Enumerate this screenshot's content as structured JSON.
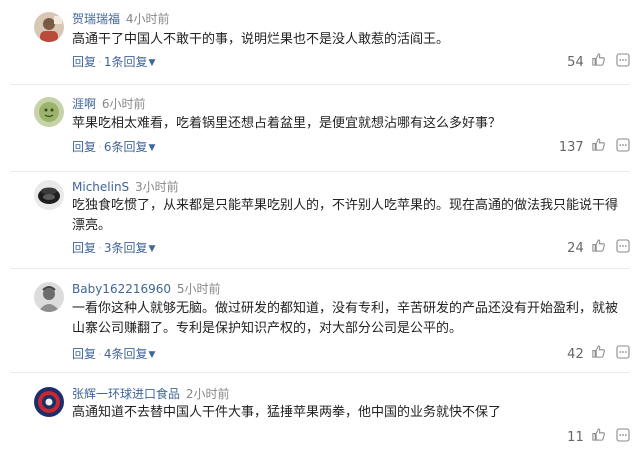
{
  "comments": [
    {
      "username": "贺瑞瑞福",
      "time": "4小时前",
      "text": "高通干了中国人不敢干的事，说明烂果也不是没人敢惹的活阎王。",
      "reply_label": "回复",
      "replies_label": "1条回复",
      "likes": "54"
    },
    {
      "username": "涯啊",
      "time": "6小时前",
      "text": "苹果吃相太难看，吃着锅里还想占着盆里，是便宜就想沾哪有这么多好事？",
      "reply_label": "回复",
      "replies_label": "6条回复",
      "likes": "137"
    },
    {
      "username": "MichelinS",
      "time": "3小时前",
      "text": "吃独食吃惯了，从来都是只能苹果吃别人的，不许别人吃苹果的。现在高通的做法我只能说干得漂亮。",
      "reply_label": "回复",
      "replies_label": "3条回复",
      "likes": "24"
    },
    {
      "username": "Baby162216960",
      "time": "5小时前",
      "text": "一看你这种人就够无脑。做过研发的都知道，没有专利，辛苦研发的产品还没有开始盈利，就被山寨公司赚翻了。专利是保护知识产权的，对大部分公司是公平的。",
      "reply_label": "回复",
      "replies_label": "4条回复",
      "likes": "42"
    },
    {
      "username": "张辉一环球进口食品",
      "time": "2小时前",
      "text": "高通知道不去替中国人干件大事，猛捶苹果两拳，他中国的业务就快不保了",
      "reply_label": "",
      "replies_label": "",
      "likes": "11"
    }
  ],
  "colors": {
    "link": "#406599",
    "time": "#888888",
    "text": "#222222",
    "likes": "#666666",
    "divider": "#ececec"
  },
  "icons": {
    "like": "thumbs-up-icon",
    "more": "more-square-icon",
    "chevron": "chevron-down-icon"
  }
}
